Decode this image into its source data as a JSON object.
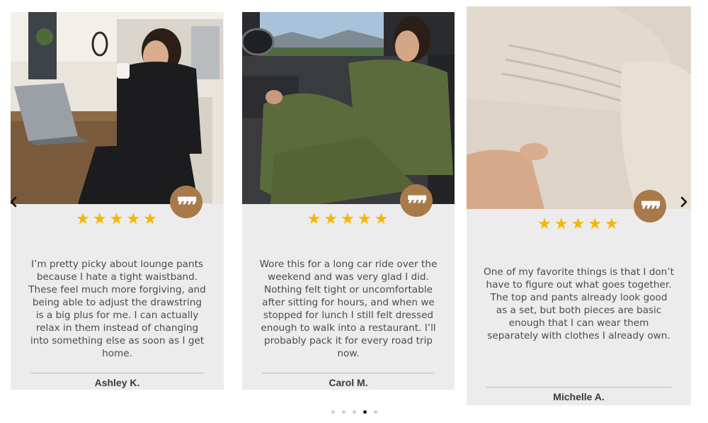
{
  "carousel": {
    "prev_icon": "chevron-left-icon",
    "next_icon": "chevron-right-icon",
    "dots_count": 5,
    "active_dot": 4
  },
  "colors": {
    "card_bg": "#ececec",
    "star": "#f7b500",
    "quote_badge": "#a87a4a",
    "text": "#4b4b4b",
    "active_dot": "#1f1f1f",
    "inactive_dot": "#cfcfcf"
  },
  "reviews": [
    {
      "rating": 5,
      "text": "I’m pretty picky about lounge pants because I hate a tight waistband. These feel much more forgiving, and being able to adjust the drawstring is a big plus for me. I can actually relax in them instead of changing into something else as soon as I get home.",
      "author": "Ashley K.",
      "photo": "woman-black-lounge-set-with-laptop-and-mug"
    },
    {
      "rating": 5,
      "text": "Wore this for a long car ride over the weekend and was very glad I did. Nothing felt tight or uncomfortable after sitting for hours, and when we stopped for lunch I still felt dressed enough to walk into a restaurant. I’ll probably pack it for every road trip now.",
      "author": "Carol M.",
      "photo": "woman-olive-lounge-set-in-car"
    },
    {
      "rating": 5,
      "text": "One of my favorite things is that I don’t have to figure out what goes together. The top and pants already look good as a set, but both pieces are basic enough that I can wear them separately with clothes I already own.",
      "author": "Michelle A.",
      "photo": "beige-lounge-set-closeup"
    }
  ]
}
